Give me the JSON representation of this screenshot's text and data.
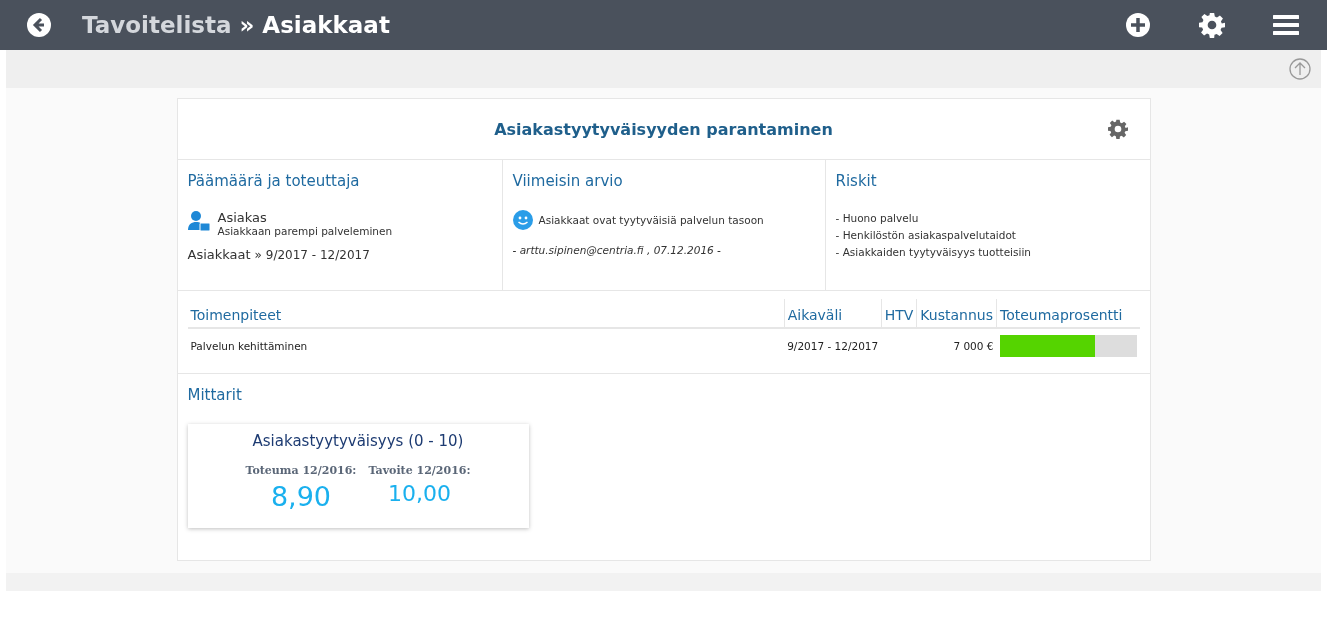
{
  "header": {
    "parent": "Tavoitelista",
    "current": "» Asiakkaat"
  },
  "goal": {
    "title": "Asiakastyytyväisyyden parantaminen",
    "owner": {
      "heading": "Päämäärä ja toteuttaja",
      "name": "Asiakas",
      "description": "Asiakkaan parempi palveleminen",
      "group": "Asiakkaat",
      "period": "» 9/2017 - 12/2017"
    },
    "assessment": {
      "heading": "Viimeisin arvio",
      "text": "Asiakkaat ovat tyytyväisiä palvelun tasoon",
      "author": "- arttu.sipinen@centria.fi , 07.12.2016 -"
    },
    "risks": {
      "heading": "Riskit",
      "items": [
        "- Huono palvelu",
        "- Henkilöstön asiakaspalvelutaidot",
        "- Asiakkaiden tyytyväisyys tuotteisiin"
      ]
    }
  },
  "actions": {
    "columns": [
      "Toimenpiteet",
      "Aikaväli",
      "HTV",
      "Kustannus",
      "Toteumaprosentti"
    ],
    "rows": [
      {
        "name": "Palvelun kehittäminen",
        "period": "9/2017 - 12/2017",
        "cost": "7 000 €",
        "level": 0.7
      }
    ]
  },
  "meters": {
    "heading": "Mittarit",
    "items": [
      {
        "title": "Asiakastyytyväisyys (0 - 10)",
        "actual_label": "Toteuma 12/2016:",
        "actual": "8,90",
        "target_label": "Tavoite 12/2016:",
        "target": "10,00"
      }
    ]
  }
}
